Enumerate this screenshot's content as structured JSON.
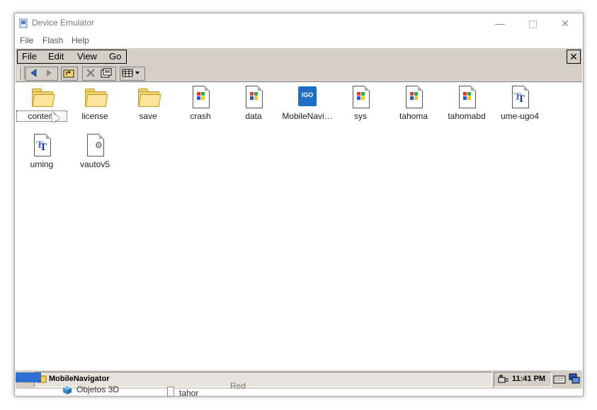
{
  "host_window": {
    "title": "Device Emulator",
    "menu": [
      "File",
      "Flash",
      "Help"
    ],
    "controls": {
      "minimize": "—",
      "close": "✕"
    }
  },
  "ce_menu": {
    "items": [
      "File",
      "Edit",
      "View",
      "Go"
    ],
    "close": "✕"
  },
  "toolbar": {
    "back_icon": "back-arrow-icon",
    "forward_icon": "forward-arrow-icon",
    "up_icon": "up-folder-icon",
    "delete_icon": "delete-icon",
    "properties_icon": "properties-icon",
    "view_icon": "view-mode-icon"
  },
  "files": [
    {
      "name": "content",
      "type": "folder",
      "selected": true
    },
    {
      "name": "license",
      "type": "folder"
    },
    {
      "name": "save",
      "type": "folder"
    },
    {
      "name": "crash",
      "type": "doc"
    },
    {
      "name": "data",
      "type": "doc"
    },
    {
      "name": "MobileNavi…",
      "type": "igo",
      "badge": "iGO"
    },
    {
      "name": "sys",
      "type": "doc"
    },
    {
      "name": "tahoma",
      "type": "doc"
    },
    {
      "name": "tahomabd",
      "type": "doc"
    },
    {
      "name": "ume-ugo4",
      "type": "font"
    },
    {
      "name": "uming",
      "type": "font"
    },
    {
      "name": "vautov5",
      "type": "gear"
    }
  ],
  "taskbar": {
    "active_task": "MobileNavigator",
    "clock": "11:41 PM"
  },
  "background_peek": {
    "items": [
      "Objetos 3D",
      "tahor",
      "Red"
    ]
  },
  "colors": {
    "ce_face": "#d4d0c8",
    "folder": "#f0d36a",
    "igo_blue": "#1f6fc4"
  }
}
